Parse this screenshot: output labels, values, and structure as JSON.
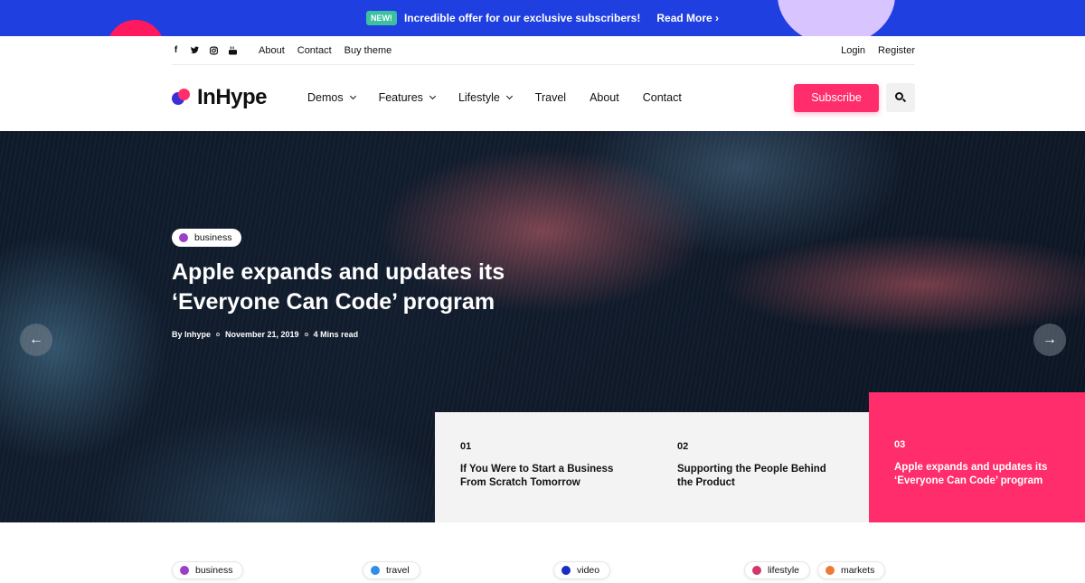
{
  "promo": {
    "badge": "NEW!",
    "message": "Incredible offer for our exclusive subscribers!",
    "read_more": "Read More ›"
  },
  "utility": {
    "social_icons": [
      "facebook-icon",
      "twitter-icon",
      "instagram-icon",
      "youtube-icon"
    ],
    "links": [
      "About",
      "Contact",
      "Buy theme"
    ],
    "auth": [
      "Login",
      "Register"
    ]
  },
  "nav": {
    "logo": "InHype",
    "items": [
      {
        "label": "Demos",
        "dropdown": true
      },
      {
        "label": "Features",
        "dropdown": true
      },
      {
        "label": "Lifestyle",
        "dropdown": true
      },
      {
        "label": "Travel",
        "dropdown": false
      },
      {
        "label": "About",
        "dropdown": false
      },
      {
        "label": "Contact",
        "dropdown": false
      }
    ],
    "subscribe": "Subscribe"
  },
  "hero": {
    "category": "business",
    "category_color": "#9b3fc8",
    "title": "Apple expands and updates its ‘Everyone Can Code’ program",
    "author": "By Inhype",
    "date": "November 21, 2019",
    "read_time": "4 Mins read"
  },
  "slides": [
    {
      "num": "01",
      "title": "If You Were to Start a Business From Scratch Tomorrow"
    },
    {
      "num": "02",
      "title": "Supporting the People Behind the Product"
    },
    {
      "num": "03",
      "title": "Apple expands and updates its ‘Everyone Can Code’ program"
    }
  ],
  "categories": [
    {
      "label": "business",
      "color": "#9b3fc8"
    },
    {
      "label": "travel",
      "color": "#2f8fe8"
    },
    {
      "label": "video",
      "color": "#1a2fc0"
    },
    {
      "label": "lifestyle",
      "color": "#d0386a"
    },
    {
      "label": "markets",
      "color": "#ee7a3a"
    }
  ],
  "colors": {
    "accent": "#ff2d6b",
    "promo_bg": "#1f3fe0"
  }
}
